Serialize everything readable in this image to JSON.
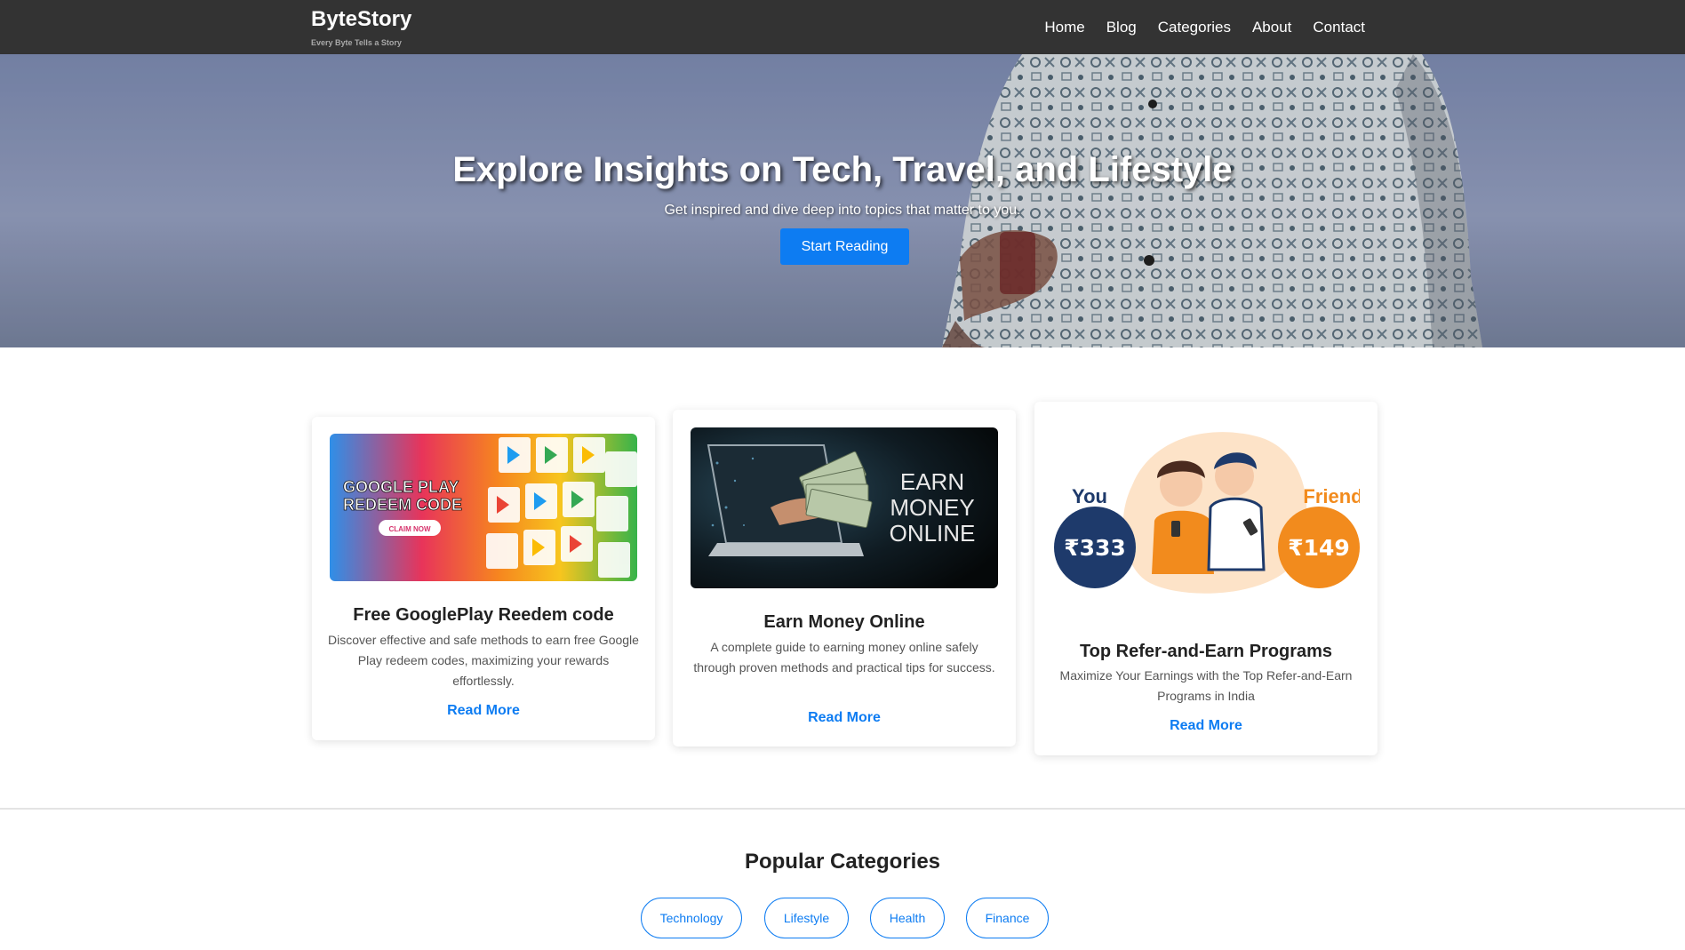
{
  "brand": {
    "title": "ByteStory",
    "tagline": "Every Byte Tells a Story"
  },
  "nav": {
    "items": [
      {
        "label": "Home"
      },
      {
        "label": "Blog"
      },
      {
        "label": "Categories"
      },
      {
        "label": "About"
      },
      {
        "label": "Contact"
      }
    ]
  },
  "hero": {
    "title": "Explore Insights on Tech, Travel, and Lifestyle",
    "subtitle": "Get inspired and dive deep into topics that matter to you.",
    "button": "Start Reading"
  },
  "posts": [
    {
      "title": "Free GooglePlay Reedem code",
      "description": "Discover effective and safe methods to earn free Google Play redeem codes, maximizing your rewards effortlessly.",
      "link": "Read More",
      "image": {
        "line1": "GOOGLE PLAY",
        "line2": "REDEEM CODE",
        "badge": "CLAIM NOW"
      }
    },
    {
      "title": "Earn Money Online",
      "description": "A complete guide to earning money online safely through proven methods and practical tips for success.",
      "link": "Read More",
      "image": {
        "line1": "EARN",
        "line2": "MONEY",
        "line3": "ONLINE"
      }
    },
    {
      "title": "Top Refer-and-Earn Programs",
      "description": "Maximize Your Earnings with the Top Refer-and-Earn Programs in India",
      "link": "Read More",
      "image": {
        "you_label": "You",
        "friend_label": "Friend",
        "you_amount": "₹333",
        "friend_amount": "₹149"
      }
    }
  ],
  "categories": {
    "heading": "Popular Categories",
    "items": [
      {
        "label": "Technology"
      },
      {
        "label": "Lifestyle"
      },
      {
        "label": "Health"
      },
      {
        "label": "Finance"
      }
    ]
  },
  "colors": {
    "nav_bg": "#333333",
    "accent": "#0d7cf2",
    "hero_sky": "#8d9ac0"
  }
}
